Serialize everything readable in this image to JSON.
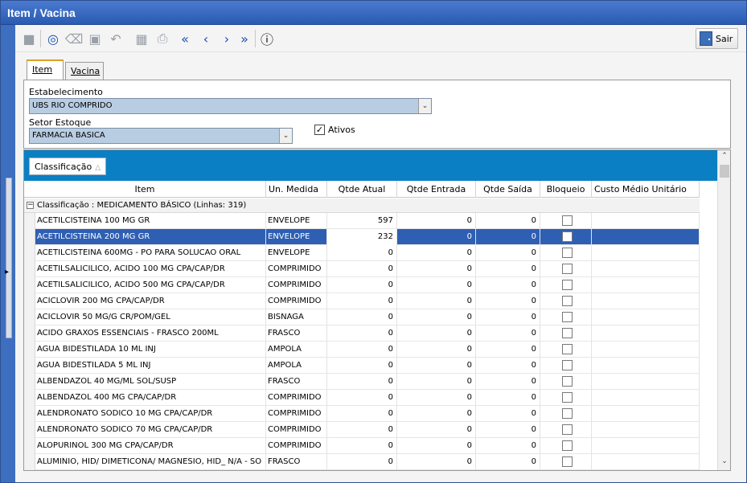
{
  "window": {
    "title": "Item / Vacina"
  },
  "toolbar": {
    "buttons": [
      "new-icon",
      "search-icon",
      "eraser-icon",
      "delete-icon",
      "undo-icon",
      "grid-icon",
      "print-icon",
      "first-icon",
      "prev-icon",
      "next-icon",
      "last-icon",
      "help-icon"
    ],
    "exit_label": "Sair"
  },
  "tabs": {
    "item_label": "Item",
    "vacina_label": "Vacina",
    "active": "Item"
  },
  "filters": {
    "estabelecimento_label": "Estabelecimento",
    "estabelecimento_value": "UBS RIO COMPRIDO",
    "setor_label": "Setor Estoque",
    "setor_value": "FARMACIA BASICA",
    "ativos_label": "Ativos",
    "ativos_checked": true
  },
  "grid": {
    "group_chip": "Classificação",
    "columns": [
      "Item",
      "Un. Medida",
      "Qtde Atual",
      "Qtde Entrada",
      "Qtde Saída",
      "Bloqueio",
      "Custo Médio Unitário"
    ],
    "group_row": "Classificação : MEDICAMENTO BÁSICO (Linhas: 319)",
    "selected_index": 1,
    "rows": [
      {
        "item": "ACETILCISTEINA 100 MG GR",
        "un": "ENVELOPE",
        "atual": "597",
        "entrada": "0",
        "saida": "0",
        "bloqueio": false,
        "custo": ""
      },
      {
        "item": "ACETILCISTEINA 200 MG GR",
        "un": "ENVELOPE",
        "atual": "232",
        "entrada": "0",
        "saida": "0",
        "bloqueio": false,
        "custo": ""
      },
      {
        "item": "ACETILCISTEINA 600MG - PO PARA SOLUCAO ORAL",
        "un": "ENVELOPE",
        "atual": "0",
        "entrada": "0",
        "saida": "0",
        "bloqueio": false,
        "custo": ""
      },
      {
        "item": "ACETILSALICILICO, ACIDO 100 MG CPA/CAP/DR",
        "un": "COMPRIMIDO",
        "atual": "0",
        "entrada": "0",
        "saida": "0",
        "bloqueio": false,
        "custo": ""
      },
      {
        "item": "ACETILSALICILICO, ACIDO 500 MG CPA/CAP/DR",
        "un": "COMPRIMIDO",
        "atual": "0",
        "entrada": "0",
        "saida": "0",
        "bloqueio": false,
        "custo": ""
      },
      {
        "item": "ACICLOVIR 200 MG CPA/CAP/DR",
        "un": "COMPRIMIDO",
        "atual": "0",
        "entrada": "0",
        "saida": "0",
        "bloqueio": false,
        "custo": ""
      },
      {
        "item": "ACICLOVIR 50 MG/G CR/POM/GEL",
        "un": "BISNAGA",
        "atual": "0",
        "entrada": "0",
        "saida": "0",
        "bloqueio": false,
        "custo": ""
      },
      {
        "item": "ACIDO GRAXOS ESSENCIAIS - FRASCO 200ML",
        "un": "FRASCO",
        "atual": "0",
        "entrada": "0",
        "saida": "0",
        "bloqueio": false,
        "custo": ""
      },
      {
        "item": "AGUA BIDESTILADA 10 ML INJ",
        "un": "AMPOLA",
        "atual": "0",
        "entrada": "0",
        "saida": "0",
        "bloqueio": false,
        "custo": ""
      },
      {
        "item": "AGUA BIDESTILADA 5 ML INJ",
        "un": "AMPOLA",
        "atual": "0",
        "entrada": "0",
        "saida": "0",
        "bloqueio": false,
        "custo": ""
      },
      {
        "item": "ALBENDAZOL 40 MG/ML SOL/SUSP",
        "un": "FRASCO",
        "atual": "0",
        "entrada": "0",
        "saida": "0",
        "bloqueio": false,
        "custo": ""
      },
      {
        "item": "ALBENDAZOL 400 MG CPA/CAP/DR",
        "un": "COMPRIMIDO",
        "atual": "0",
        "entrada": "0",
        "saida": "0",
        "bloqueio": false,
        "custo": ""
      },
      {
        "item": "ALENDRONATO SODICO 10 MG CPA/CAP/DR",
        "un": "COMPRIMIDO",
        "atual": "0",
        "entrada": "0",
        "saida": "0",
        "bloqueio": false,
        "custo": ""
      },
      {
        "item": "ALENDRONATO SODICO 70 MG CPA/CAP/DR",
        "un": "COMPRIMIDO",
        "atual": "0",
        "entrada": "0",
        "saida": "0",
        "bloqueio": false,
        "custo": ""
      },
      {
        "item": "ALOPURINOL 300 MG CPA/CAP/DR",
        "un": "COMPRIMIDO",
        "atual": "0",
        "entrada": "0",
        "saida": "0",
        "bloqueio": false,
        "custo": ""
      },
      {
        "item": "ALUMINIO, HID/ DIMETICONA/ MAGNESIO, HID_ N/A - SO",
        "un": "FRASCO",
        "atual": "0",
        "entrada": "0",
        "saida": "0",
        "bloqueio": false,
        "custo": ""
      }
    ]
  },
  "colors": {
    "title_bar": "#2a5bb3",
    "group_bar": "#0b7fc4",
    "selected_row": "#2f5fb3",
    "combo_bg": "#b9cde2"
  }
}
